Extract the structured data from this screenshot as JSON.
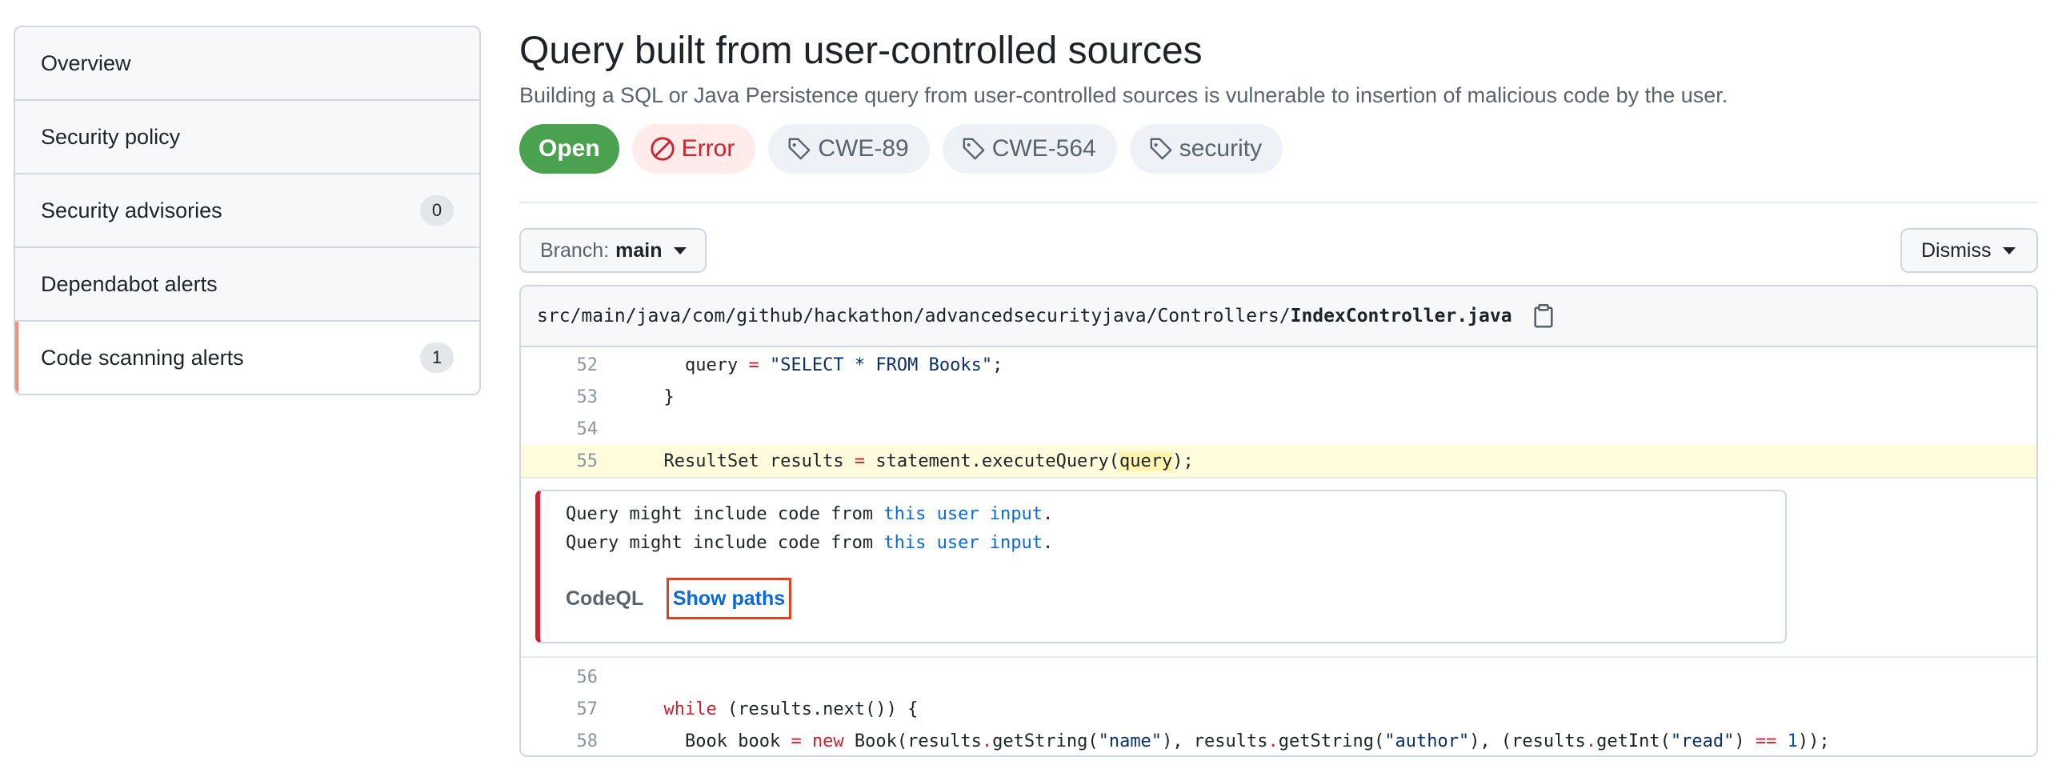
{
  "sidebar": {
    "items": [
      {
        "label": "Overview"
      },
      {
        "label": "Security policy"
      },
      {
        "label": "Security advisories",
        "count": "0"
      },
      {
        "label": "Dependabot alerts"
      },
      {
        "label": "Code scanning alerts",
        "count": "1",
        "active": true
      }
    ]
  },
  "alert": {
    "title": "Query built from user-controlled sources",
    "description": "Building a SQL or Java Persistence query from user-controlled sources is vulnerable to insertion of malicious code by the user.",
    "status": "Open",
    "severity": "Error",
    "tags": [
      "CWE-89",
      "CWE-564",
      "security"
    ]
  },
  "controls": {
    "branch_label": "Branch:",
    "branch_value": "main",
    "dismiss_label": "Dismiss"
  },
  "file": {
    "path": "src/main/java/com/github/hackathon/advancedsecurityjava/Controllers/",
    "name": "IndexController.java"
  },
  "code": {
    "l52": "52",
    "l53": "53",
    "l54": "54",
    "l55": "55",
    "l56": "56",
    "l57": "57",
    "l58": "58"
  },
  "message": {
    "prefix": "Query might include code from ",
    "link": "this user input",
    "suffix": ".",
    "tool": "CodeQL",
    "show_paths": "Show paths"
  },
  "colors": {
    "open": "#4aa14f",
    "error_bg": "#ffebe9",
    "error_fg": "#cf222e",
    "accent_border": "#fd8c73",
    "highlight": "#e0411e"
  }
}
